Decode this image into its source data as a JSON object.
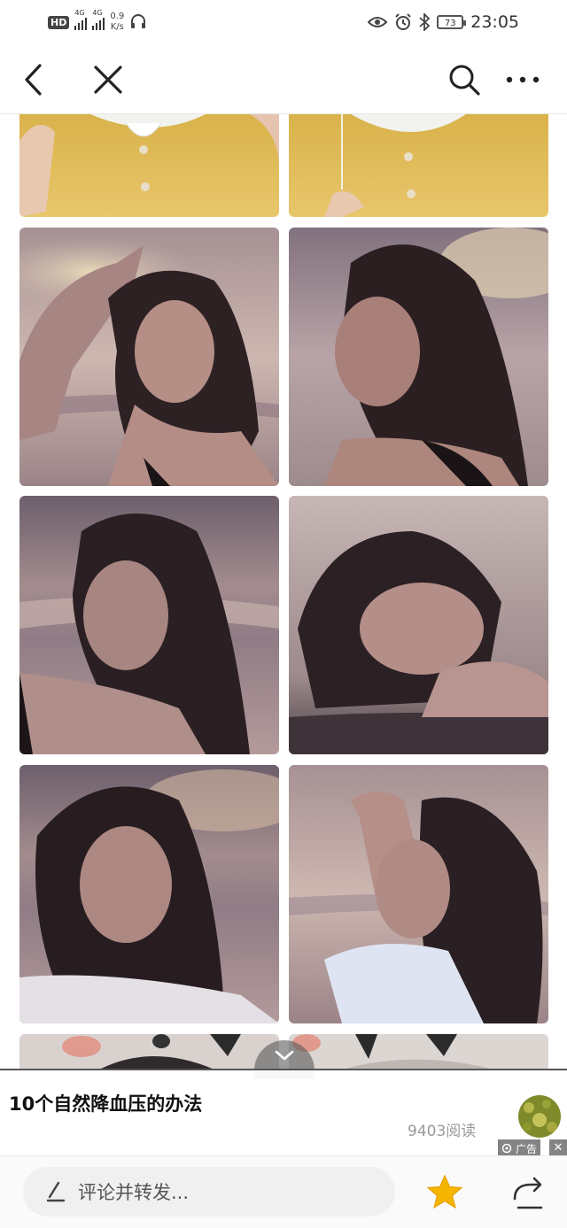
{
  "status_bar": {
    "hd": "HD",
    "net1": "4G",
    "net2": "4G",
    "speed_value": "0.9",
    "speed_unit": "K/s",
    "battery": "73",
    "time": "23:05"
  },
  "nav": {
    "back_icon": "chevron-left-icon",
    "close_icon": "close-icon",
    "search_icon": "search-icon",
    "more_icon": "more-icon"
  },
  "article": {
    "title": "10个自然降血压的办法",
    "reads": "9403阅读",
    "ad_label": "广告",
    "ad_close": "✕"
  },
  "bottom": {
    "comment_placeholder": "评论并转发...",
    "favorite_icon": "star-icon",
    "share_icon": "share-icon"
  },
  "colors": {
    "accent_star": "#f5b400",
    "text_dark": "#111111"
  }
}
